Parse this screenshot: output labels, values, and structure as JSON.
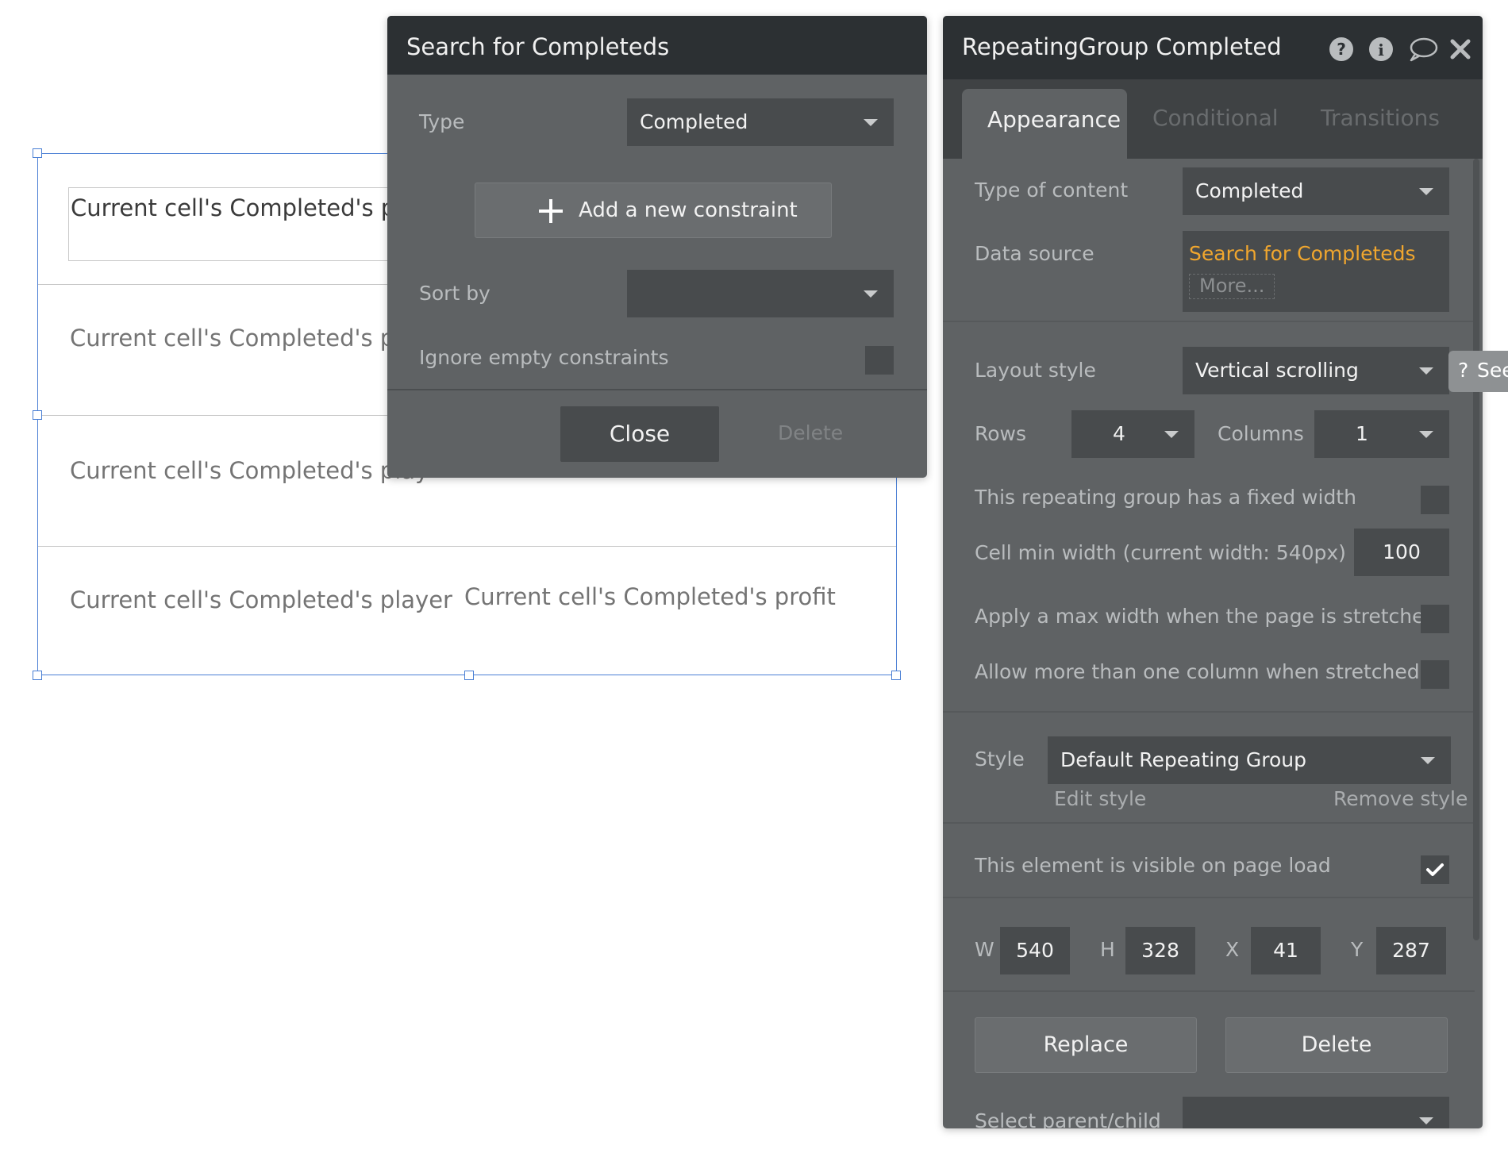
{
  "canvas": {
    "cell_input_text": "Current cell's Completed's pla",
    "row2_text": "Current cell's Completed's pla",
    "row3_text": "Current cell's Completed's play",
    "row4_player": "Current cell's Completed's player",
    "row4_profit": "Current cell's Completed's profit"
  },
  "search_popup": {
    "title": "Search for Completeds",
    "type_label": "Type",
    "type_value": "Completed",
    "add_constraint_label": "Add a new constraint",
    "sort_by_label": "Sort by",
    "sort_by_value": "",
    "ignore_empty_label": "Ignore empty constraints",
    "close_label": "Close",
    "delete_label": "Delete"
  },
  "property_editor": {
    "title": "RepeatingGroup Completed",
    "tabs": [
      "Appearance",
      "Conditional",
      "Transitions"
    ],
    "type_of_content_label": "Type of content",
    "type_of_content_value": "Completed",
    "data_source_label": "Data source",
    "data_source_value": "Search for Completeds",
    "more_label": "More...",
    "layout_style_label": "Layout style",
    "layout_style_value": "Vertical scrolling",
    "rows_label": "Rows",
    "rows_value": "4",
    "columns_label": "Columns",
    "columns_value": "1",
    "fixed_width_label": "This repeating group has a fixed width",
    "cell_min_width_label": "Cell min width (current width: 540px)",
    "cell_min_width_value": "100",
    "max_width_label": "Apply a max width when the page is stretched",
    "more_columns_label": "Allow more than one column when stretched",
    "style_label": "Style",
    "style_value": "Default Repeating Group",
    "edit_style_label": "Edit style",
    "remove_style_label": "Remove style",
    "visible_label": "This element is visible on page load",
    "visible_checked": true,
    "w_label": "W",
    "w_value": "540",
    "h_label": "H",
    "h_value": "328",
    "x_label": "X",
    "x_value": "41",
    "y_label": "Y",
    "y_value": "287",
    "replace_label": "Replace",
    "delete_label": "Delete",
    "parent_child_label": "Select parent/child"
  },
  "see_tab": {
    "label": "See"
  },
  "colors": {
    "panel_bg": "#5f6264",
    "header_bg": "#2c3033",
    "input_bg": "#484b4d",
    "accent_orange": "#f0a62e",
    "selection_blue": "#4a7fd4"
  },
  "icons": [
    "help-icon",
    "info-icon",
    "comment-icon",
    "close-icon",
    "plus-icon",
    "chevron-down-icon",
    "checkmark-icon",
    "question-icon"
  ]
}
